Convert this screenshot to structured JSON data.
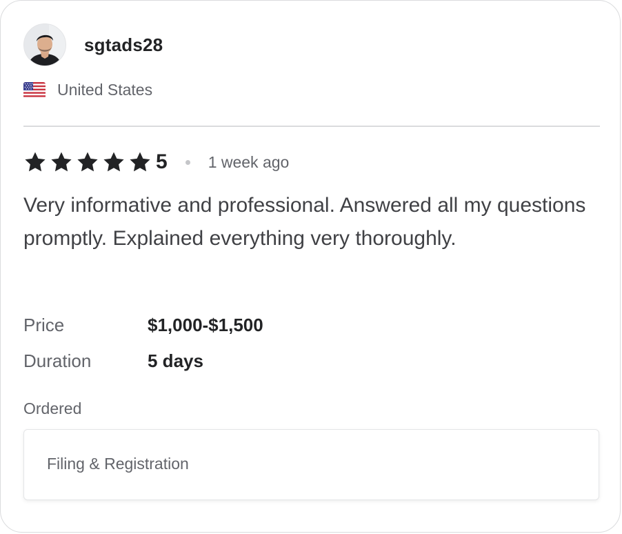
{
  "reviewer": {
    "username": "sgtads28",
    "country": "United States",
    "avatar_icon": "user-avatar",
    "flag_icon": "us-flag-icon"
  },
  "rating": {
    "stars": 5,
    "value": "5",
    "time_ago": "1 week ago",
    "star_color": "#222325"
  },
  "review": {
    "text": "Very informative and professional. Answered all my questions promptly. Explained everything very thoroughly."
  },
  "details": {
    "price_label": "Price",
    "price_value": "$1,000-$1,500",
    "duration_label": "Duration",
    "duration_value": "5 days"
  },
  "ordered": {
    "label": "Ordered",
    "item": "Filing & Registration"
  }
}
